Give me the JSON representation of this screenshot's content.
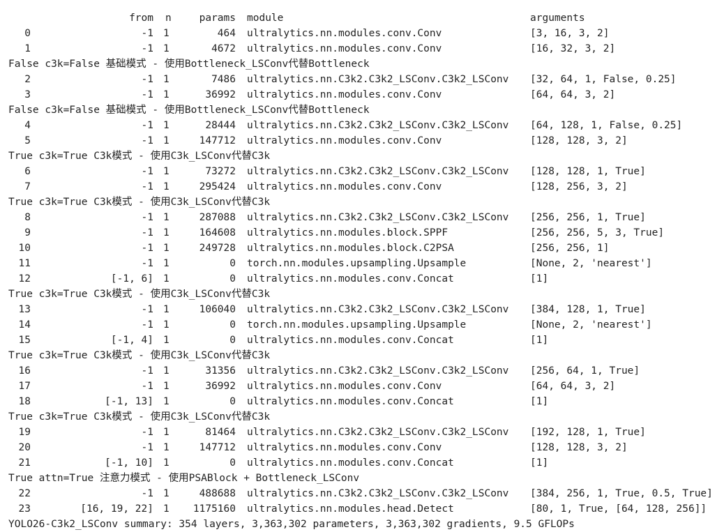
{
  "header": {
    "from": "from",
    "n": "n",
    "params": "params",
    "module": "module",
    "arguments": "arguments"
  },
  "lines": [
    {
      "kind": "row",
      "idx": "0",
      "from": "-1",
      "n": "1",
      "params": "464",
      "module": "ultralytics.nn.modules.conv.Conv",
      "args": "[3, 16, 3, 2]"
    },
    {
      "kind": "row",
      "idx": "1",
      "from": "-1",
      "n": "1",
      "params": "4672",
      "module": "ultralytics.nn.modules.conv.Conv",
      "args": "[16, 32, 3, 2]"
    },
    {
      "kind": "msg",
      "text": "False c3k=False 基础模式 - 使用Bottleneck_LSConv代替Bottleneck"
    },
    {
      "kind": "row",
      "idx": "2",
      "from": "-1",
      "n": "1",
      "params": "7486",
      "module": "ultralytics.nn.C3k2.C3k2_LSConv.C3k2_LSConv",
      "args": "[32, 64, 1, False, 0.25]"
    },
    {
      "kind": "row",
      "idx": "3",
      "from": "-1",
      "n": "1",
      "params": "36992",
      "module": "ultralytics.nn.modules.conv.Conv",
      "args": "[64, 64, 3, 2]"
    },
    {
      "kind": "msg",
      "text": "False c3k=False 基础模式 - 使用Bottleneck_LSConv代替Bottleneck"
    },
    {
      "kind": "row",
      "idx": "4",
      "from": "-1",
      "n": "1",
      "params": "28444",
      "module": "ultralytics.nn.C3k2.C3k2_LSConv.C3k2_LSConv",
      "args": "[64, 128, 1, False, 0.25]"
    },
    {
      "kind": "row",
      "idx": "5",
      "from": "-1",
      "n": "1",
      "params": "147712",
      "module": "ultralytics.nn.modules.conv.Conv",
      "args": "[128, 128, 3, 2]"
    },
    {
      "kind": "msg",
      "text": "True c3k=True C3k模式 - 使用C3k_LSConv代替C3k"
    },
    {
      "kind": "row",
      "idx": "6",
      "from": "-1",
      "n": "1",
      "params": "73272",
      "module": "ultralytics.nn.C3k2.C3k2_LSConv.C3k2_LSConv",
      "args": "[128, 128, 1, True]"
    },
    {
      "kind": "row",
      "idx": "7",
      "from": "-1",
      "n": "1",
      "params": "295424",
      "module": "ultralytics.nn.modules.conv.Conv",
      "args": "[128, 256, 3, 2]"
    },
    {
      "kind": "msg",
      "text": "True c3k=True C3k模式 - 使用C3k_LSConv代替C3k"
    },
    {
      "kind": "row",
      "idx": "8",
      "from": "-1",
      "n": "1",
      "params": "287088",
      "module": "ultralytics.nn.C3k2.C3k2_LSConv.C3k2_LSConv",
      "args": "[256, 256, 1, True]"
    },
    {
      "kind": "row",
      "idx": "9",
      "from": "-1",
      "n": "1",
      "params": "164608",
      "module": "ultralytics.nn.modules.block.SPPF",
      "args": "[256, 256, 5, 3, True]"
    },
    {
      "kind": "row",
      "idx": "10",
      "from": "-1",
      "n": "1",
      "params": "249728",
      "module": "ultralytics.nn.modules.block.C2PSA",
      "args": "[256, 256, 1]"
    },
    {
      "kind": "row",
      "idx": "11",
      "from": "-1",
      "n": "1",
      "params": "0",
      "module": "torch.nn.modules.upsampling.Upsample",
      "args": "[None, 2, 'nearest']"
    },
    {
      "kind": "row",
      "idx": "12",
      "from": "[-1, 6]",
      "n": "1",
      "params": "0",
      "module": "ultralytics.nn.modules.conv.Concat",
      "args": "[1]"
    },
    {
      "kind": "msg",
      "text": "True c3k=True C3k模式 - 使用C3k_LSConv代替C3k"
    },
    {
      "kind": "row",
      "idx": "13",
      "from": "-1",
      "n": "1",
      "params": "106040",
      "module": "ultralytics.nn.C3k2.C3k2_LSConv.C3k2_LSConv",
      "args": "[384, 128, 1, True]"
    },
    {
      "kind": "row",
      "idx": "14",
      "from": "-1",
      "n": "1",
      "params": "0",
      "module": "torch.nn.modules.upsampling.Upsample",
      "args": "[None, 2, 'nearest']"
    },
    {
      "kind": "row",
      "idx": "15",
      "from": "[-1, 4]",
      "n": "1",
      "params": "0",
      "module": "ultralytics.nn.modules.conv.Concat",
      "args": "[1]"
    },
    {
      "kind": "msg",
      "text": "True c3k=True C3k模式 - 使用C3k_LSConv代替C3k"
    },
    {
      "kind": "row",
      "idx": "16",
      "from": "-1",
      "n": "1",
      "params": "31356",
      "module": "ultralytics.nn.C3k2.C3k2_LSConv.C3k2_LSConv",
      "args": "[256, 64, 1, True]"
    },
    {
      "kind": "row",
      "idx": "17",
      "from": "-1",
      "n": "1",
      "params": "36992",
      "module": "ultralytics.nn.modules.conv.Conv",
      "args": "[64, 64, 3, 2]"
    },
    {
      "kind": "row",
      "idx": "18",
      "from": "[-1, 13]",
      "n": "1",
      "params": "0",
      "module": "ultralytics.nn.modules.conv.Concat",
      "args": "[1]"
    },
    {
      "kind": "msg",
      "text": "True c3k=True C3k模式 - 使用C3k_LSConv代替C3k"
    },
    {
      "kind": "row",
      "idx": "19",
      "from": "-1",
      "n": "1",
      "params": "81464",
      "module": "ultralytics.nn.C3k2.C3k2_LSConv.C3k2_LSConv",
      "args": "[192, 128, 1, True]"
    },
    {
      "kind": "row",
      "idx": "20",
      "from": "-1",
      "n": "1",
      "params": "147712",
      "module": "ultralytics.nn.modules.conv.Conv",
      "args": "[128, 128, 3, 2]"
    },
    {
      "kind": "row",
      "idx": "21",
      "from": "[-1, 10]",
      "n": "1",
      "params": "0",
      "module": "ultralytics.nn.modules.conv.Concat",
      "args": "[1]"
    },
    {
      "kind": "msg",
      "text": "True attn=True 注意力模式 - 使用PSABlock + Bottleneck_LSConv"
    },
    {
      "kind": "row",
      "idx": "22",
      "from": "-1",
      "n": "1",
      "params": "488688",
      "module": "ultralytics.nn.C3k2.C3k2_LSConv.C3k2_LSConv",
      "args": "[384, 256, 1, True, 0.5, True]"
    },
    {
      "kind": "row",
      "idx": "23",
      "from": "[16, 19, 22]",
      "n": "1",
      "params": "1175160",
      "module": "ultralytics.nn.modules.head.Detect",
      "args": "[80, 1, True, [64, 128, 256]]"
    }
  ],
  "summary": "YOLO26-C3k2_LSConv summary: 354 layers, 3,363,302 parameters, 3,363,302 gradients, 9.5 GFLOPs"
}
